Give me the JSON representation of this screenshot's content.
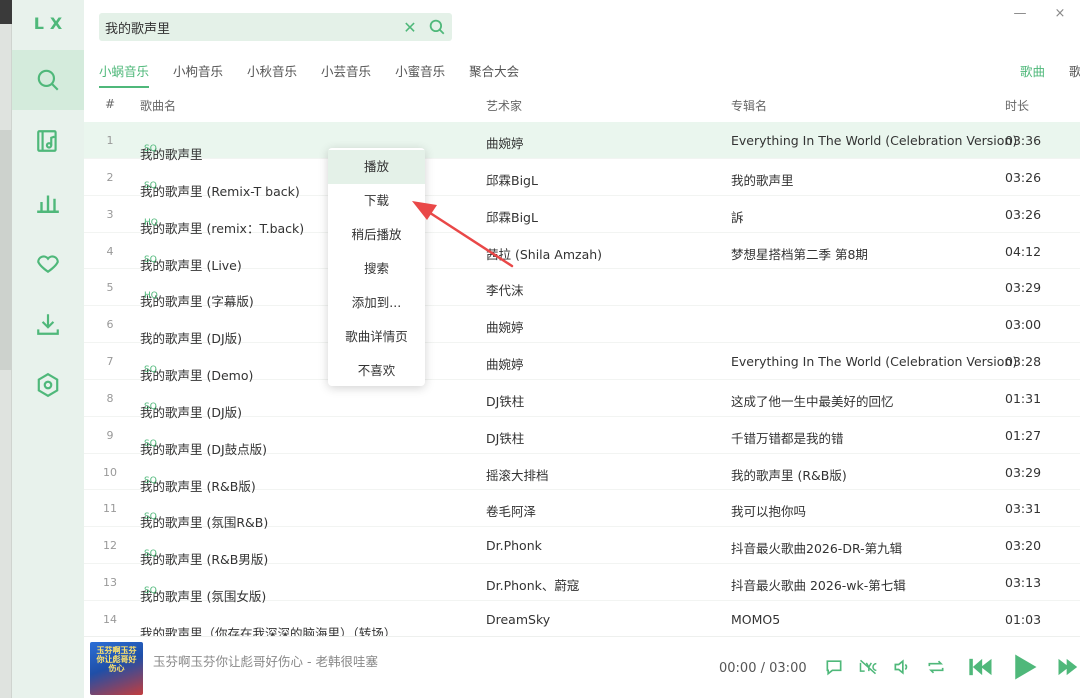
{
  "app": {
    "logo": "LX"
  },
  "search": {
    "value": "我的歌声里",
    "clear": "✕"
  },
  "window": {
    "minimize": "—",
    "close": "×"
  },
  "sources": [
    "小蜗音乐",
    "小枸音乐",
    "小秋音乐",
    "小芸音乐",
    "小蜜音乐",
    "聚合大会"
  ],
  "types": [
    "歌曲",
    "歌单"
  ],
  "table": {
    "headers": {
      "num": "#",
      "name": "歌曲名",
      "artist": "艺术家",
      "album": "专辑名",
      "duration": "时长"
    },
    "rows": [
      {
        "num": "1",
        "name": "我的歌声里",
        "quality": "SQ",
        "artist": "曲婉婷",
        "album": "Everything In The World (Celebration Version)",
        "duration": "03:36"
      },
      {
        "num": "2",
        "name": "我的歌声里 (Remix-T back)",
        "quality": "SQ",
        "artist": "邱霖BigL",
        "album": "我的歌声里",
        "duration": "03:26"
      },
      {
        "num": "3",
        "name": "我的歌声里 (remix：T.back)",
        "quality": "HQ",
        "artist": "邱霖BigL",
        "album": "訴",
        "duration": "03:26"
      },
      {
        "num": "4",
        "name": "我的歌声里 (Live)",
        "quality": "SQ",
        "artist": "茜拉 (Shila Amzah)",
        "album": "梦想星搭档第二季 第8期",
        "duration": "04:12"
      },
      {
        "num": "5",
        "name": "我的歌声里 (字幕版)",
        "quality": "HQ",
        "artist": "李代沫",
        "album": "",
        "duration": "03:29"
      },
      {
        "num": "6",
        "name": "我的歌声里 (DJ版)",
        "quality": "",
        "artist": "曲婉婷",
        "album": "",
        "duration": "03:00"
      },
      {
        "num": "7",
        "name": "我的歌声里 (Demo)",
        "quality": "SQ",
        "artist": "曲婉婷",
        "album": "Everything In The World (Celebration Version)",
        "duration": "03:28"
      },
      {
        "num": "8",
        "name": "我的歌声里 (DJ版)",
        "quality": "SQ",
        "artist": "DJ铁柱",
        "album": "这成了他一生中最美好的回忆",
        "duration": "01:31"
      },
      {
        "num": "9",
        "name": "我的歌声里 (DJ鼓点版)",
        "quality": "SQ",
        "artist": "DJ铁柱",
        "album": "千错万错都是我的错",
        "duration": "01:27"
      },
      {
        "num": "10",
        "name": "我的歌声里 (R&B版)",
        "quality": "SQ",
        "artist": "摇滚大排档",
        "album": "我的歌声里 (R&B版)",
        "duration": "03:29"
      },
      {
        "num": "11",
        "name": "我的歌声里 (氛围R&B)",
        "quality": "SQ",
        "artist": "卷毛阿泽",
        "album": "我可以抱你吗",
        "duration": "03:31"
      },
      {
        "num": "12",
        "name": "我的歌声里 (R&B男版)",
        "quality": "SQ",
        "artist": "Dr.Phonk",
        "album": "抖音最火歌曲2026-DR-第九辑",
        "duration": "03:20"
      },
      {
        "num": "13",
        "name": "我的歌声里 (氛围女版)",
        "quality": "SQ",
        "artist": "Dr.Phonk、蔚寇",
        "album": "抖音最火歌曲 2026-wk-第七辑",
        "duration": "03:13"
      },
      {
        "num": "14",
        "name": "我的歌声里（你存在我深深的脑海里）（转场）",
        "quality": "",
        "artist": "DreamSky",
        "album": "MOMO5",
        "duration": "01:03"
      }
    ]
  },
  "context_menu": [
    "播放",
    "下载",
    "稍后播放",
    "搜索",
    "添加到...",
    "歌曲详情页",
    "不喜欢"
  ],
  "player": {
    "cover_caption": "玉芬啊玉芬 你让彪哥好伤心",
    "track": "玉芬啊玉芬你让彪哥好伤心 - 老韩很哇塞",
    "current": "00:00",
    "total": "03:00",
    "separator": "/"
  },
  "colors": {
    "accent": "#4fb87a",
    "annotation": "#e94848"
  }
}
